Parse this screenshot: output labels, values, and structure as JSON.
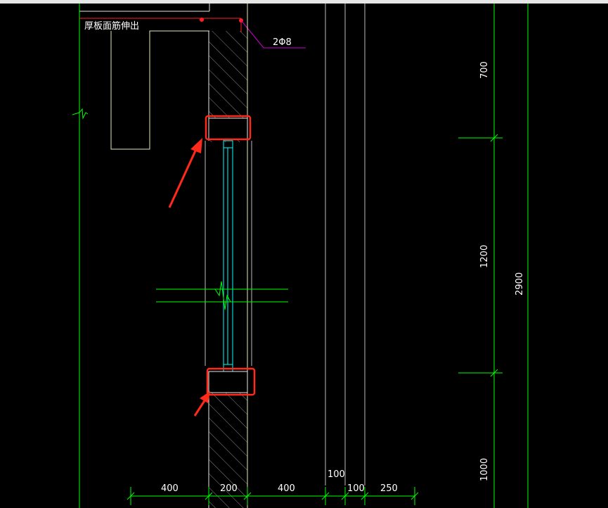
{
  "window": {
    "title_bar_color": "#e6e6e6"
  },
  "drawing": {
    "top_note": "厚板面筋伸出",
    "rebar_callout": "2Φ8",
    "dim_vertical": [
      "700",
      "1200",
      "2900",
      "1000"
    ],
    "dim_horizontal": [
      "400",
      "200",
      "400",
      "100",
      "100",
      "250"
    ]
  },
  "colors": {
    "background": "#000000",
    "axis_line": "#00ff00",
    "wall_outline": "#e8e8b0",
    "window_frame": "#00ffff",
    "rebar_line": "#ff2020",
    "callout_line": "#cc00cc",
    "highlight_box": "#ff2a1a",
    "dimension_text": "#ffffff",
    "hatch": "#9a9a9a"
  },
  "icons": [
    "arrow-annotation-icon",
    "break-line-icon"
  ]
}
